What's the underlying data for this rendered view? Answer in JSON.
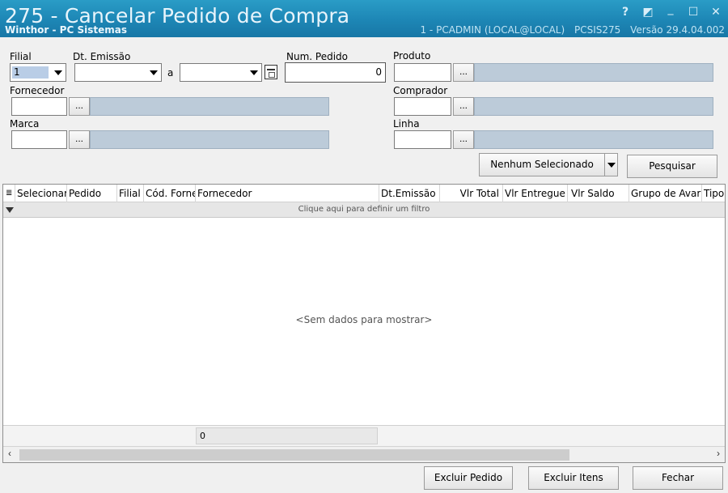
{
  "window": {
    "title": "275 - Cancelar Pedido de Compra",
    "subtitle": "Winthor - PC Sistemas",
    "session_user": "1 - PCADMIN (LOCAL@LOCAL)",
    "session_module": "PCSIS275",
    "session_version": "Versão  29.4.04.002",
    "help_glyph": "?",
    "restore_glyph": "◩",
    "minimize_glyph": "_",
    "maximize_glyph": "☐",
    "close_glyph": "✕"
  },
  "form": {
    "filial_label": "Filial",
    "filial_value": "1",
    "dt_emissao_label": "Dt. Emissão",
    "dt_separator": "a",
    "num_pedido_label": "Num. Pedido",
    "num_pedido_value": "0",
    "produto_label": "Produto",
    "fornecedor_label": "Fornecedor",
    "comprador_label": "Comprador",
    "marca_label": "Marca",
    "linha_label": "Linha",
    "lookup_label": "..."
  },
  "actions": {
    "selection_label": "Nenhum Selecionado",
    "pesquisar_label": "Pesquisar",
    "excluir_pedido_label": "Excluir Pedido",
    "excluir_itens_label": "Excluir Itens",
    "fechar_label": "Fechar"
  },
  "grid": {
    "columns": [
      "Selecionar",
      "Pedido",
      "Filial",
      "Cód. Fornec",
      "Fornecedor",
      "Dt.Emissão",
      "Vlr Total",
      "Vlr Entregue",
      "Vlr Saldo",
      "Grupo de Avaria",
      "Tipo"
    ],
    "filter_text": "Clique aqui para definir um filtro",
    "empty_text": "<Sem dados para mostrar>",
    "footer_sum": "0"
  }
}
